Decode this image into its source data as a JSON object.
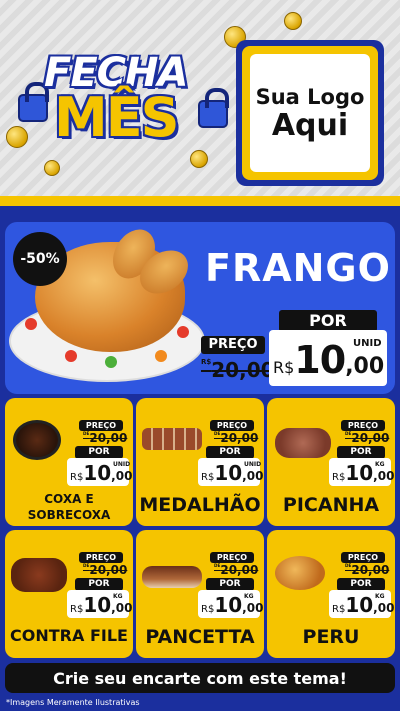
{
  "headline": {
    "line1": "FECHA",
    "line2": "MÊS"
  },
  "logo": {
    "line1": "Sua Logo",
    "line2": "Aqui"
  },
  "feature": {
    "badge": "-50%",
    "title": "FRANGO",
    "preco_label": "PREÇO",
    "old_prefix": "R$",
    "old_price": "20,00",
    "por_label": "POR",
    "currency": "R$",
    "price_int": "10",
    "price_dec": ",00",
    "unit": "UNID"
  },
  "products": [
    {
      "name_l1": "COXA E",
      "name_l2": "SOBRECOXA",
      "preco_label": "PREÇO",
      "old_prefix": "DE",
      "old_price": "20,00",
      "por_label": "POR",
      "currency": "R$",
      "price_int": "10",
      "price_dec": ",00",
      "unit": "UNID"
    },
    {
      "name_l1": "MEDALHÃO",
      "preco_label": "PREÇO",
      "old_prefix": "DE",
      "old_price": "20,00",
      "por_label": "POR",
      "currency": "R$",
      "price_int": "10",
      "price_dec": ",00",
      "unit": "UNID"
    },
    {
      "name_l1": "PICANHA",
      "preco_label": "PREÇO",
      "old_prefix": "DE",
      "old_price": "20,00",
      "por_label": "POR",
      "currency": "R$",
      "price_int": "10",
      "price_dec": ",00",
      "unit": "KG"
    },
    {
      "name_l1": "CONTRA FILE",
      "preco_label": "PREÇO",
      "old_prefix": "DE",
      "old_price": "20,00",
      "por_label": "POR",
      "currency": "R$",
      "price_int": "10",
      "price_dec": ",00",
      "unit": "KG"
    },
    {
      "name_l1": "PANCETTA",
      "preco_label": "PREÇO",
      "old_prefix": "DE",
      "old_price": "20,00",
      "por_label": "POR",
      "currency": "R$",
      "price_int": "10",
      "price_dec": ",00",
      "unit": "KG"
    },
    {
      "name_l1": "PERU",
      "preco_label": "PREÇO",
      "old_prefix": "DE",
      "old_price": "20,00",
      "por_label": "POR",
      "currency": "R$",
      "price_int": "10",
      "price_dec": ",00",
      "unit": "KG"
    }
  ],
  "cta": "Crie seu encarte com este tema!",
  "disclaimer": "*Imagens Meramente Ilustrativas",
  "colors": {
    "blue": "#1b2f9e",
    "feature_blue": "#2f56e0",
    "yellow": "#f5c400",
    "black": "#111111"
  }
}
